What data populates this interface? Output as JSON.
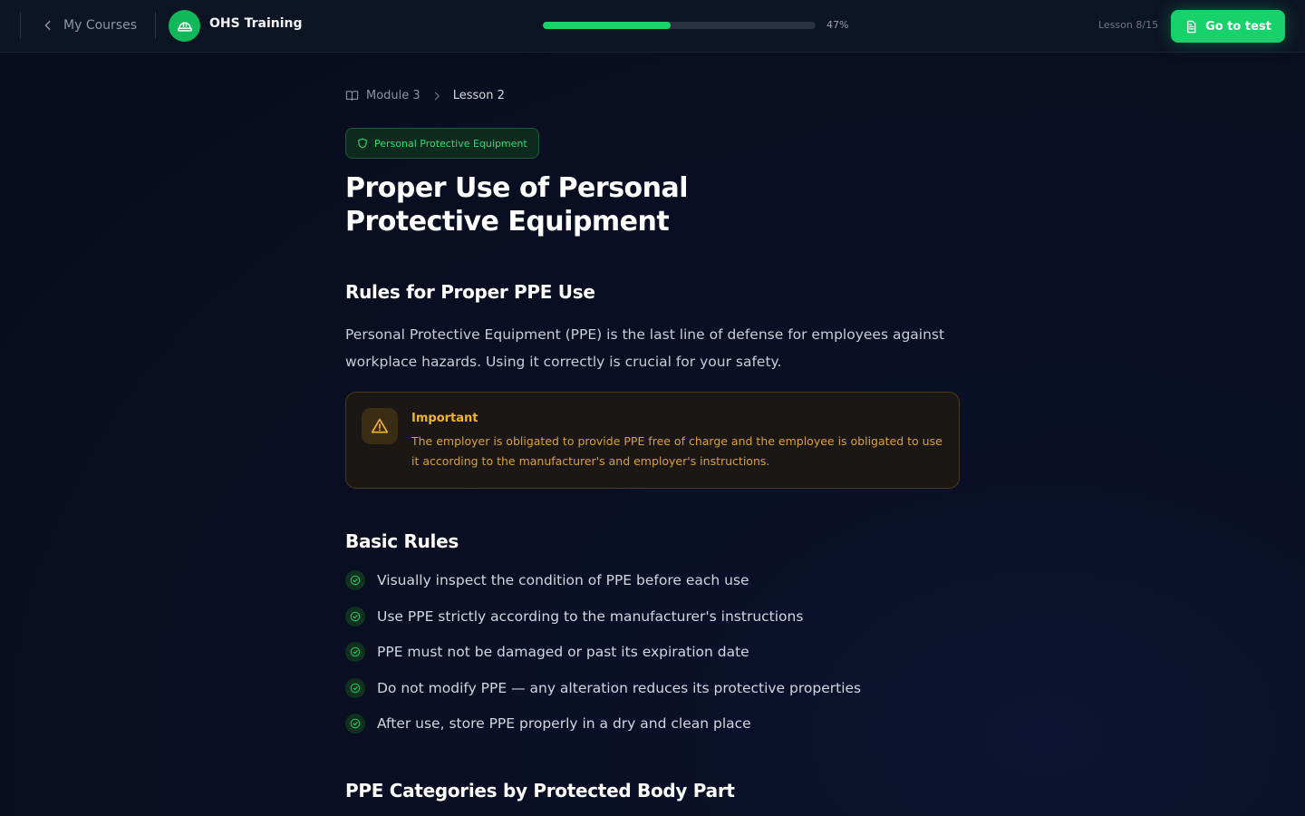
{
  "header": {
    "back_label": "My Courses",
    "course_title": "OHS Training",
    "progress": {
      "percent": 47,
      "label": "47%"
    },
    "lesson_counter": "Lesson 8/15",
    "go_to_test_label": "Go to test"
  },
  "breadcrumb": {
    "module": "Module 3",
    "lesson": "Lesson 2"
  },
  "topic_badge": "Personal Protective Equipment",
  "lesson_title": "Proper Use of Personal Protective Equipment",
  "section1": {
    "heading": "Rules for Proper PPE Use",
    "intro": "Personal Protective Equipment (PPE) is the last line of defense for employees against workplace hazards. Using it correctly is crucial for your safety."
  },
  "callout": {
    "title": "Important",
    "text": "The employer is obligated to provide PPE free of charge and the employee is obligated to use it according to the manufacturer's and employer's instructions."
  },
  "section2": {
    "heading": "Basic Rules",
    "rules": [
      "Visually inspect the condition of PPE before each use",
      "Use PPE strictly according to the manufacturer's instructions",
      "PPE must not be damaged or past its expiration date",
      "Do not modify PPE — any alteration reduces its protective properties",
      "After use, store PPE properly in a dry and clean place"
    ]
  },
  "section3": {
    "heading": "PPE Categories by Protected Body Part"
  },
  "colors": {
    "accent": "#17d16b",
    "warning": "#f2b42a",
    "background": "#0a0f24"
  }
}
